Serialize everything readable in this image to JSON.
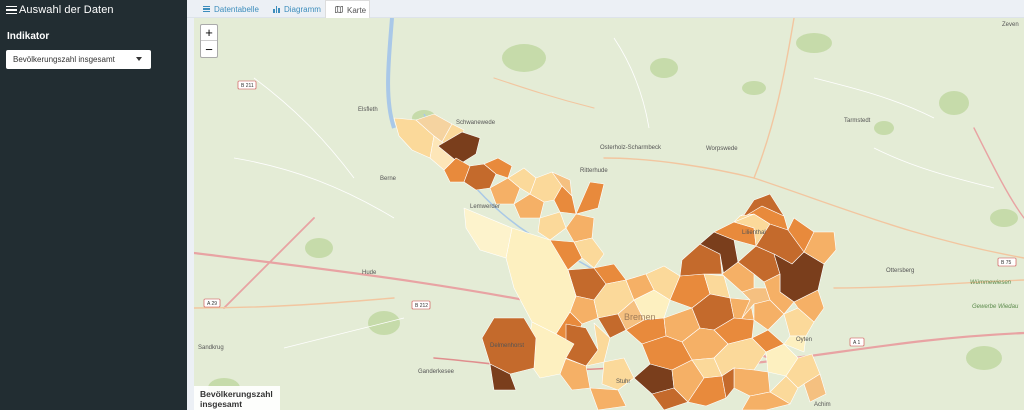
{
  "sidebar": {
    "title": "Auswahl der Daten",
    "indicator_label": "Indikator",
    "select_value": "Bevölkerungszahl insgesamt"
  },
  "tabs": [
    {
      "label": "Datentabelle",
      "active": false
    },
    {
      "label": "Diagramm",
      "active": false
    },
    {
      "label": "Karte",
      "active": true
    }
  ],
  "map": {
    "zoom_in": "+",
    "zoom_out": "−",
    "legend_title": "Bevölkerungszahl insgesamt",
    "places": [
      "Schwanewede",
      "Osterholz-Scharmbeck",
      "Worpswede",
      "Tarmstedt",
      "Zeven",
      "Elsfleth",
      "Berne",
      "Ritterhude",
      "Lemwerder",
      "Lilienthal",
      "Hude",
      "Ottersberg",
      "Delmenhorst",
      "Ganderkesee",
      "Sandkrug",
      "Oyten",
      "Stuhr",
      "Achim",
      "Bremen",
      "Wümmewiesen",
      "Gewerbe Wiedau"
    ],
    "roads": [
      "B 211",
      "B 212",
      "A 29",
      "A 1",
      "B 75"
    ],
    "colors": {
      "lightest": "#fdf0c0",
      "light": "#fbd99a",
      "mid": "#f5b066",
      "orange": "#e88a3c",
      "dark": "#c46a2c",
      "darkest": "#7a3e1c"
    }
  }
}
